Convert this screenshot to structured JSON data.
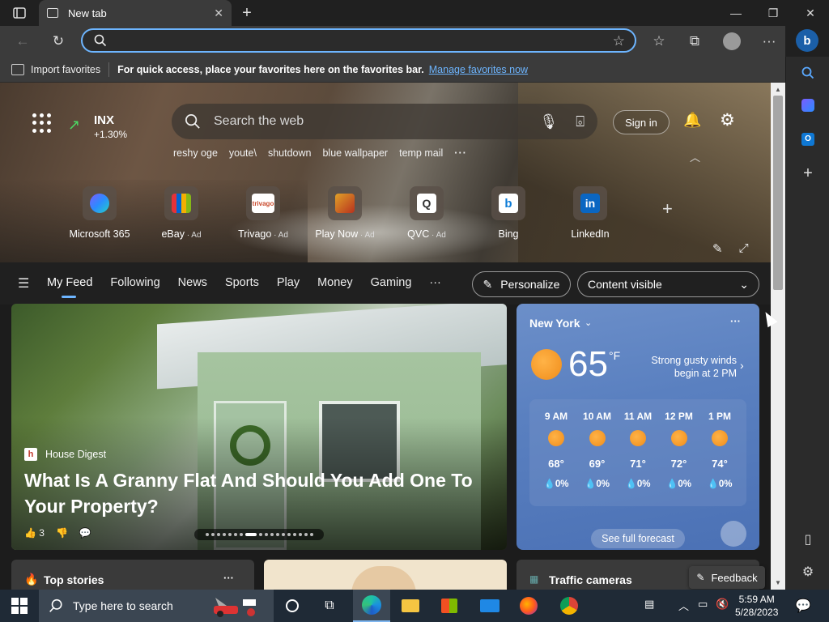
{
  "browser": {
    "tab_title": "New tab",
    "address_value": "",
    "address_placeholder": ""
  },
  "favorites_bar": {
    "import_label": "Import favorites",
    "message": "For quick access, place your favorites here on the favorites bar.",
    "manage_link": "Manage favorites now"
  },
  "newtab": {
    "stock": {
      "symbol": "INX",
      "change": "+1.30%"
    },
    "search_placeholder": "Search the web",
    "sign_in": "Sign in",
    "trending": [
      "reshy oge",
      "youte\\",
      "shutdown",
      "blue wallpaper",
      "temp mail"
    ],
    "quick_links": [
      {
        "label": "Microsoft 365",
        "ad": ""
      },
      {
        "label": "eBay",
        "ad": " · Ad"
      },
      {
        "label": "Trivago",
        "ad": " · Ad"
      },
      {
        "label": "Play Now",
        "ad": " · Ad"
      },
      {
        "label": "QVC",
        "ad": " · Ad"
      },
      {
        "label": "Bing",
        "ad": ""
      },
      {
        "label": "LinkedIn",
        "ad": ""
      }
    ],
    "trivago_logo_text": "trivago",
    "linkedin_logo_text": "in",
    "bing_logo_text": "b",
    "qvc_logo_text": "Q"
  },
  "feed_nav": {
    "items": [
      "My Feed",
      "Following",
      "News",
      "Sports",
      "Play",
      "Money",
      "Gaming"
    ],
    "personalize": "Personalize",
    "content_visible": "Content visible"
  },
  "main_story": {
    "source": "House Digest",
    "source_logo": "h",
    "headline": "What Is A Granny Flat And Should You Add One To Your Property?",
    "likes": "3"
  },
  "weather": {
    "city": "New York",
    "temp": "65",
    "unit": "°F",
    "alert": "Strong gusty winds begin at 2 PM",
    "hourly": [
      {
        "time": "9 AM",
        "temp": "68°",
        "precip": "0%"
      },
      {
        "time": "10 AM",
        "temp": "69°",
        "precip": "0%"
      },
      {
        "time": "11 AM",
        "temp": "71°",
        "precip": "0%"
      },
      {
        "time": "12 PM",
        "temp": "72°",
        "precip": "0%"
      },
      {
        "time": "1 PM",
        "temp": "74°",
        "precip": "0%"
      }
    ],
    "see_forecast": "See full forecast"
  },
  "bottom_cards": {
    "top_stories": "Top stories",
    "traffic": "Traffic cameras",
    "feedback": "Feedback"
  },
  "taskbar": {
    "search_placeholder": "Type here to search",
    "time": "5:59 AM",
    "date": "5/28/2023",
    "notification_count": "1"
  },
  "colors": {
    "accent": "#6db5ff",
    "titlebar": "#202020",
    "toolbar": "#3b3b3b",
    "taskbar": "#1f2a36",
    "weather_card": "#5a80c0"
  },
  "icons": {
    "tab_actions": "tab-actions-icon",
    "back": "back-arrow-icon",
    "refresh": "refresh-icon",
    "favorites": "favorites-icon",
    "collections": "collections-icon",
    "profile": "profile-icon",
    "more": "more-icon",
    "bing": "bing-icon"
  }
}
